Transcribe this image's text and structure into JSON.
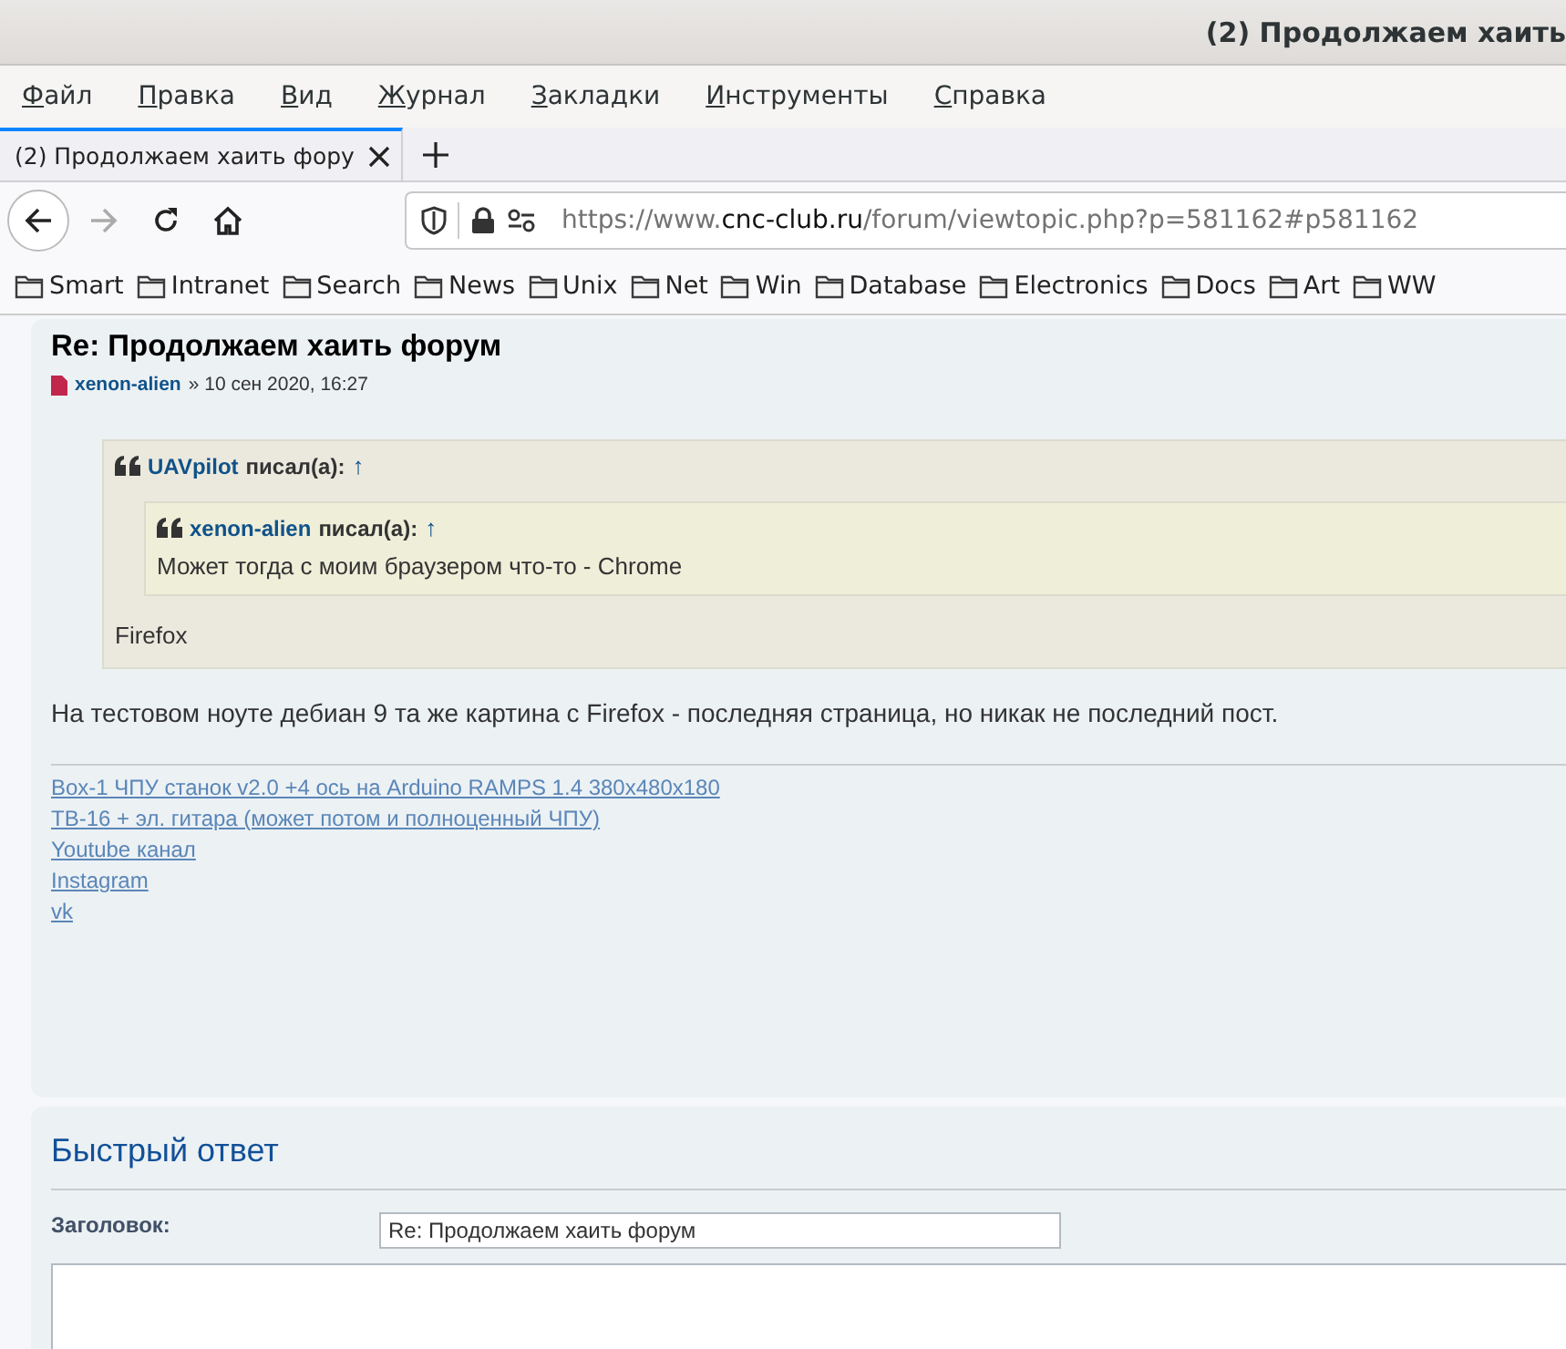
{
  "window": {
    "title": "(2) Продолжаем хаить"
  },
  "menu": [
    "Файл",
    "Правка",
    "Вид",
    "Журнал",
    "Закладки",
    "Инструменты",
    "Справка"
  ],
  "tabs": [
    {
      "label": "(2) Продолжаем хаить фору",
      "selected": true
    }
  ],
  "address": {
    "prefix": "https://www.",
    "domain": "cnc-club.ru",
    "path": "/forum/viewtopic.php?p=581162#p581162"
  },
  "bookmarks": [
    "Smart",
    "Intranet",
    "Search",
    "News",
    "Unix",
    "Net",
    "Win",
    "Database",
    "Electronics",
    "Docs",
    "Art",
    "WW"
  ],
  "post": {
    "title": "Re: Продолжаем хаить форум",
    "author": "xenon-alien",
    "date": "» 10 сен 2020, 16:27",
    "quote": {
      "author": "UAVpilot",
      "wrote": "писал(а):",
      "arrow": "↑",
      "nested": {
        "author": "xenon-alien",
        "wrote": "писал(а):",
        "arrow": "↑",
        "text": "Может тогда с моим браузером что-то - Chrome"
      },
      "text": "Firefox"
    },
    "body": "На тестовом ноуте дебиан 9 та же картина с Firefox - последняя страница, но никак не последний пост.",
    "signature": [
      "Box-1 ЧПУ станок v2.0 +4 ось на Arduino RAMPS 1.4 380x480x180",
      "ТВ-16 + эл. гитара (может потом и полноценный ЧПУ)",
      "Youtube канал",
      "Instagram",
      "vk"
    ]
  },
  "quick_reply": {
    "title": "Быстрый ответ",
    "subject_label": "Заголовок:",
    "subject_value": "Re: Продолжаем хаить форум"
  }
}
